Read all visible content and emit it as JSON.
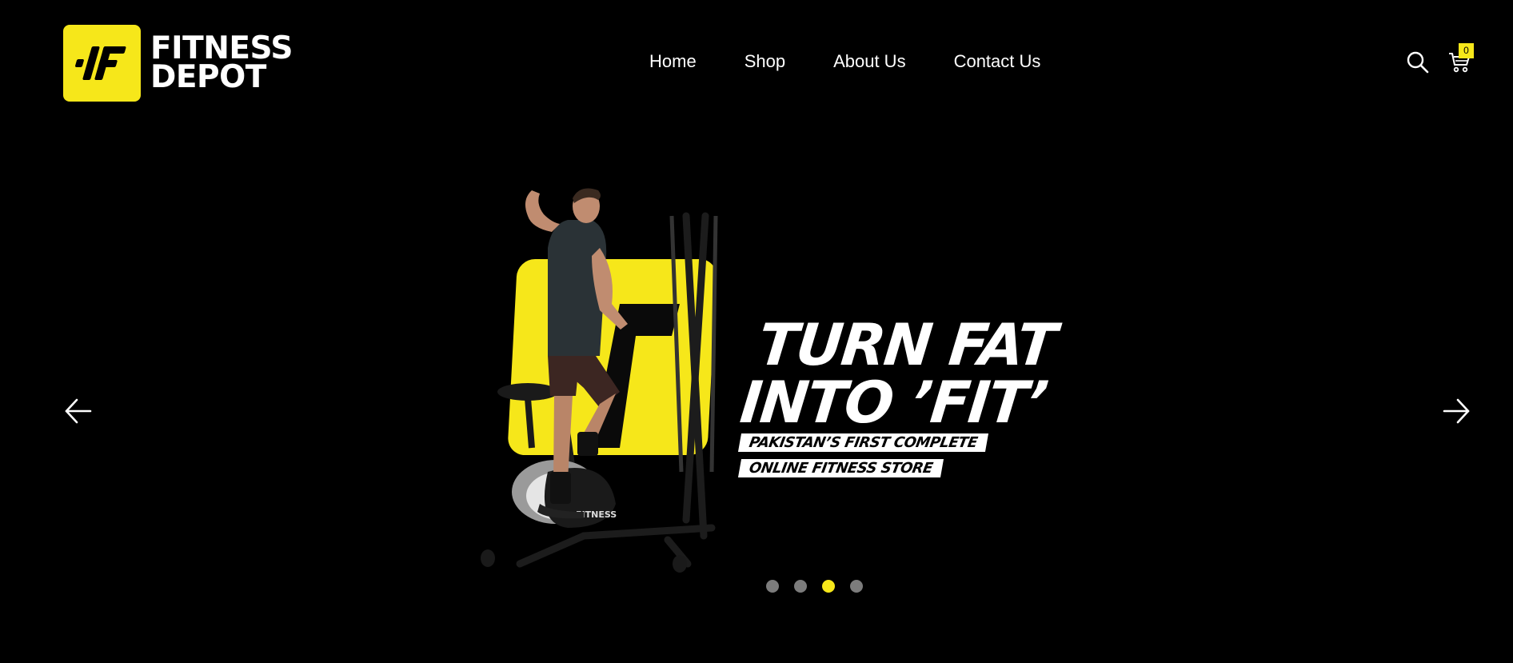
{
  "brand": {
    "name_line1": "FITNESS",
    "name_line2": "DEPOT",
    "logo_color": "#f6e71a"
  },
  "nav": {
    "items": [
      {
        "label": "Home"
      },
      {
        "label": "Shop"
      },
      {
        "label": "About Us"
      },
      {
        "label": "Contact Us"
      }
    ]
  },
  "header_actions": {
    "search_icon": "search-icon",
    "cart_icon": "cart-icon",
    "cart_count": "0"
  },
  "hero": {
    "headline_line1": "TURN FAT",
    "headline_line2": "INTO ’FIT’",
    "tagline_line1": "PAKISTAN’S FIRST COMPLETE",
    "tagline_line2": "ONLINE FITNESS STORE",
    "image_description": "man-on-elliptical-trainer",
    "machine_brand_text": "FITNESS"
  },
  "slider": {
    "prev_icon": "arrow-left-icon",
    "next_icon": "arrow-right-icon",
    "slide_count": 4,
    "active_index": 2
  },
  "colors": {
    "background": "#000000",
    "accent": "#f6e71a",
    "text": "#ffffff",
    "dot_inactive": "#7c7c7c"
  }
}
